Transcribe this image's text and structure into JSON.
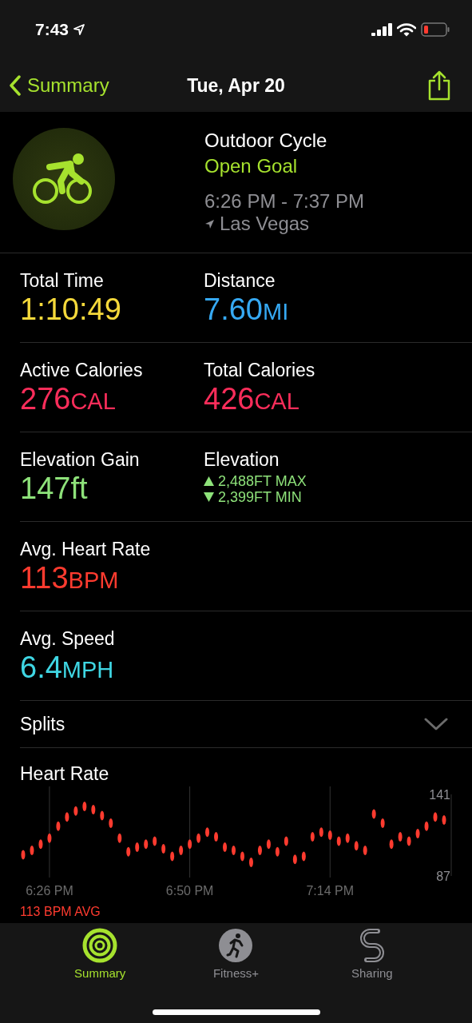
{
  "status_bar": {
    "time": "7:43"
  },
  "nav": {
    "back": "Summary",
    "title": "Tue, Apr 20"
  },
  "workout": {
    "name": "Outdoor Cycle",
    "goal": "Open Goal",
    "time_range": "6:26 PM - 7:37 PM",
    "location": "Las Vegas"
  },
  "stats": [
    {
      "cells": [
        {
          "kind": "value",
          "label": "Total Time",
          "value": "1:10:49",
          "color": "#f5d93b"
        },
        {
          "kind": "value",
          "label": "Distance",
          "value": "7.60",
          "unit": "MI",
          "color": "#36a9f3"
        }
      ]
    },
    {
      "cells": [
        {
          "kind": "value",
          "label": "Active Calories",
          "value": "276",
          "unit": "CAL",
          "color": "#fa2d5a"
        },
        {
          "kind": "value",
          "label": "Total Calories",
          "value": "426",
          "unit": "CAL",
          "color": "#fa2d5a"
        }
      ]
    },
    {
      "cells": [
        {
          "kind": "value",
          "label": "Elevation Gain",
          "value": "147ft",
          "color": "#8ee27a"
        },
        {
          "kind": "range",
          "label": "Elevation",
          "color": "#8ee27a",
          "lines": [
            {
              "kind": "up",
              "text": "2,488FT MAX"
            },
            {
              "kind": "down",
              "text": "2,399FT MIN"
            }
          ]
        }
      ]
    },
    {
      "cells": [
        {
          "kind": "value",
          "label": "Avg. Heart Rate",
          "value": "113",
          "unit": "BPM",
          "color": "#ff3b2f"
        }
      ]
    },
    {
      "cells": [
        {
          "kind": "value",
          "label": "Avg. Speed",
          "value": "6.4",
          "unit": "MPH",
          "color": "#3fd6e3"
        }
      ]
    }
  ],
  "splits": {
    "label": "Splits",
    "expanded": false
  },
  "heart_rate": {
    "title": "Heart Rate",
    "average": "113 BPM AVG",
    "chart_data": {
      "type": "scatter",
      "grid": true,
      "ylim": [
        87,
        141
      ],
      "yticks": [
        141,
        87
      ],
      "categories": [
        null,
        null,
        null,
        "6:26 PM",
        null,
        null,
        null,
        null,
        null,
        null,
        null,
        null,
        null,
        null,
        null,
        null,
        null,
        null,
        null,
        "6:50 PM",
        null,
        null,
        null,
        null,
        null,
        null,
        null,
        null,
        null,
        null,
        null,
        null,
        null,
        null,
        null,
        "7:14 PM",
        null,
        null,
        null,
        null,
        null,
        null,
        null,
        null,
        null,
        null,
        null,
        null,
        null
      ],
      "series": [
        {
          "color": "#ff3b2f",
          "values": [
            101,
            104,
            108,
            112,
            120,
            126,
            130,
            133,
            131,
            127,
            122,
            112,
            103,
            106,
            108,
            110,
            105,
            100,
            104,
            108,
            112,
            116,
            113,
            106,
            104,
            100,
            96,
            104,
            108,
            103,
            110,
            98,
            100,
            113,
            116,
            114,
            110,
            112,
            107,
            104,
            128,
            122,
            108,
            113,
            110,
            115,
            120,
            126,
            124
          ]
        }
      ]
    }
  },
  "tabs": [
    {
      "kind": "summary",
      "label": "Summary",
      "selected": true
    },
    {
      "kind": "fitness",
      "label": "Fitness+",
      "selected": false
    },
    {
      "kind": "sharing",
      "label": "Sharing",
      "selected": false
    }
  ]
}
